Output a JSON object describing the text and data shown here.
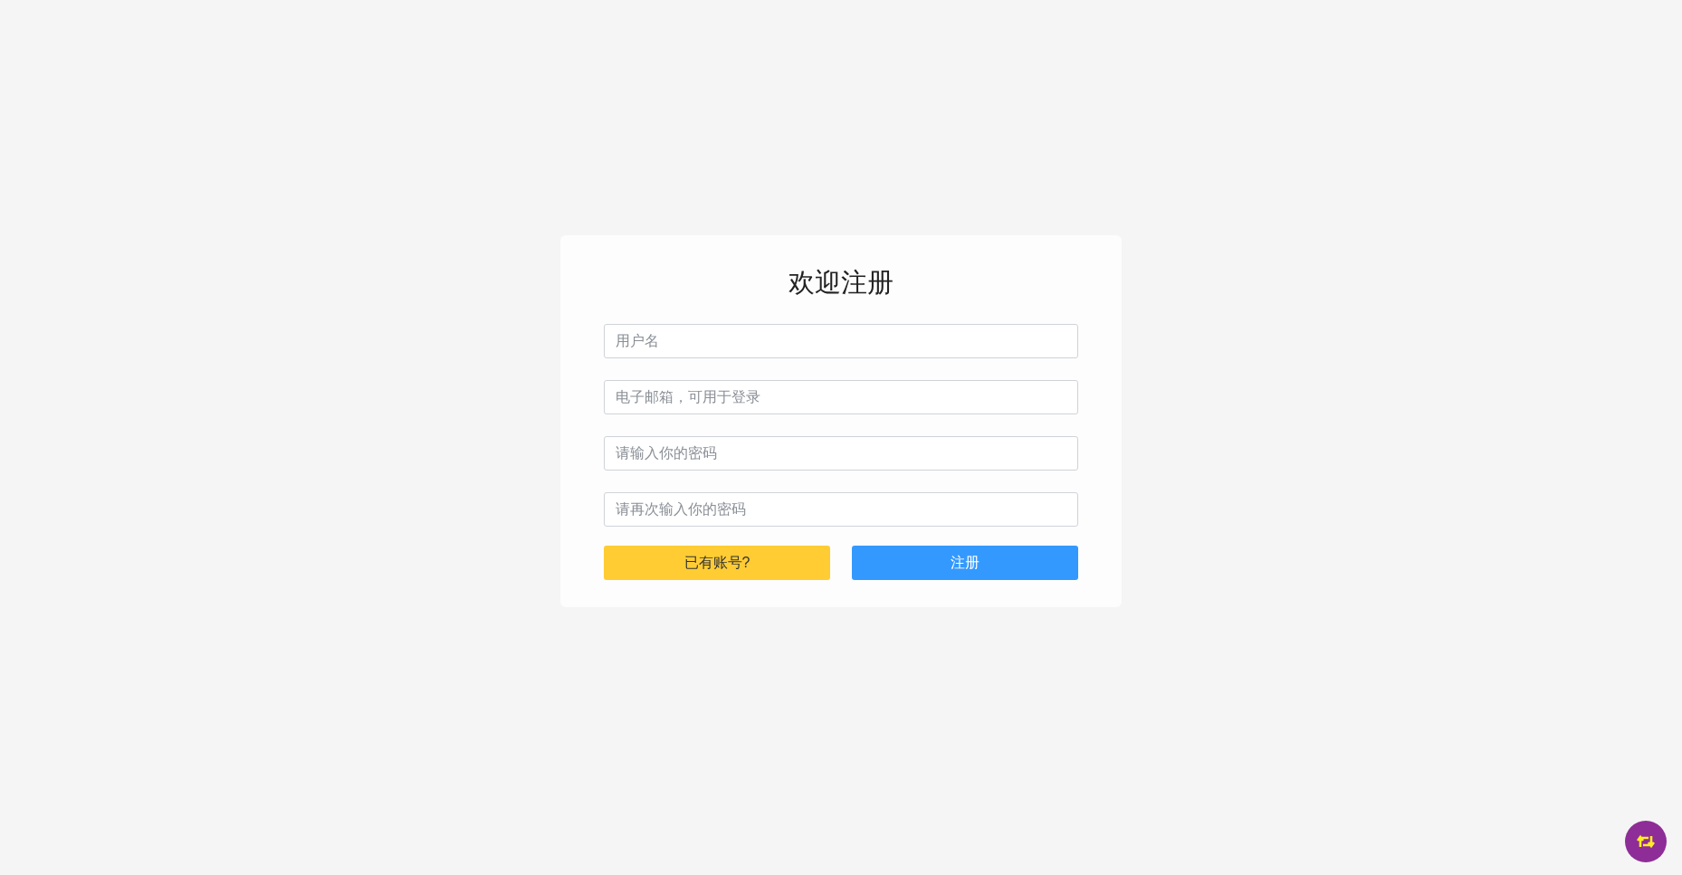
{
  "title": "欢迎注册",
  "fields": [
    {
      "placeholder": "用户名"
    },
    {
      "placeholder": "电子邮箱，可用于登录"
    },
    {
      "placeholder": "请输入你的密码"
    },
    {
      "placeholder": "请再次输入你的密码"
    }
  ],
  "buttons": [
    {
      "label": "已有账号?",
      "kind": "secondary"
    },
    {
      "label": "注册",
      "kind": "primary"
    }
  ]
}
